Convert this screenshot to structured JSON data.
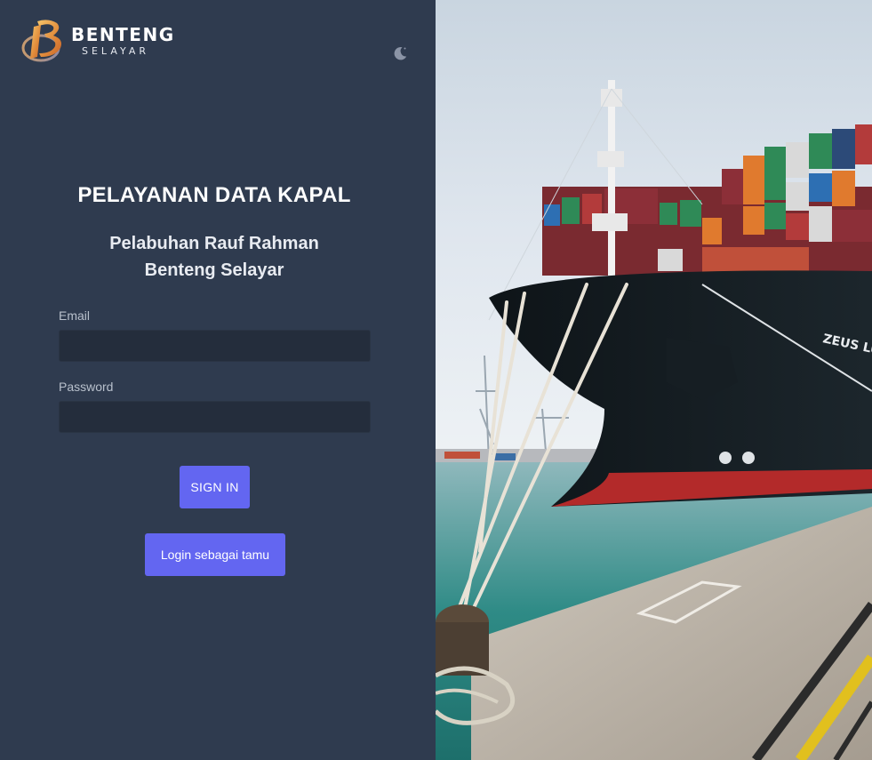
{
  "brand": {
    "name": "BENTENG",
    "tagline": "SELAYAR"
  },
  "header": {
    "theme_toggle_icon": "moon-icon"
  },
  "page": {
    "title": "PELAYANAN DATA KAPAL",
    "subtitle_line1": "Pelabuhan Rauf Rahman",
    "subtitle_line2": "Benteng Selayar"
  },
  "form": {
    "email_label": "Email",
    "email_value": "",
    "password_label": "Password",
    "password_value": "",
    "signin_label": "SIGN IN",
    "guest_label": "Login sebagai tamu"
  },
  "hero": {
    "ship_name": "ZEUS LU"
  },
  "colors": {
    "panel_bg": "#2f3b4f",
    "input_bg": "#242d3c",
    "accent": "#6366f1"
  }
}
